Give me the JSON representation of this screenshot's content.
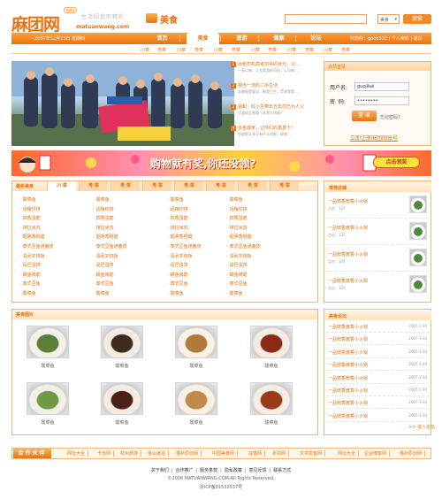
{
  "header": {
    "logo_cn": "麻团网",
    "logo_en": "matuanwang.com",
    "beta": "beta",
    "slogan": "生活因我而精彩",
    "channel": "美食",
    "search_select": "美食",
    "search_button": "搜索"
  },
  "nav": {
    "date": "2007年12月13日 星期四",
    "items": [
      "首页",
      "美食",
      "旅游",
      "健康",
      "论坛"
    ],
    "active": "美食",
    "userbar": "欢迎你：good532 | 个人资料 | 退出"
  },
  "subnav": [
    "川菜",
    "粤菜",
    "川菜",
    "粤菜",
    "川菜",
    "粤菜",
    "川菜",
    "粤菜",
    "川菜",
    "粤菜",
    "川菜",
    "粤菜"
  ],
  "news": [
    {
      "num": "1",
      "title": "出租司机高考前中的状元，公…",
      "desc": "一直以来，公交简游的司机，公司有…"
    },
    {
      "num": "2",
      "title": "相当一流的二手生活",
      "desc": "长期接受复议，断是卫生，苛求等等…"
    },
    {
      "num": "3",
      "title": "温和：红小生带年五年前已为人父",
      "desc": "过渡成怎感道《非常大明星》"
    },
    {
      "num": "4",
      "title": "省色或家，让你们的勇基下!",
      "desc": "你说那么多又有什么用呢，很幸…"
    }
  ],
  "login": {
    "title": "会员登录",
    "user_label": "用户名:",
    "user_value": "guojikai",
    "pass_label": "密  码:",
    "pass_value": "••••••••",
    "submit": "登 录",
    "forgot": "忘记密码?",
    "register": "立即注册麻团网账号"
  },
  "banner": {
    "text": "购物就有奖,你还没领?",
    "button": "点击领奖"
  },
  "recipes": {
    "title": "最新美食",
    "tabs": [
      "川 菜",
      "粤 菜",
      "粤 菜",
      "粤 菜",
      "粤 菜",
      "粤 菜",
      "粤 菜",
      "粤 菜"
    ],
    "columns": [
      [
        "酸菜鱼",
        "话梅仔排",
        "四香蛋筋",
        "排拉米苏",
        "烟熏香棍醋",
        "泰式豆鱼通鹿皮",
        "清武叉烧饭",
        "是巴蛋饼",
        "鳗鱼烤筋",
        "泰式豆鱼",
        "酸菜鱼"
      ],
      [
        "酸菜鱼",
        "话梅仔排",
        "四香蛋筋",
        "排拉米苏",
        "烟熏香棍醋",
        "泰式豆鱼通鹿皮",
        "清武叉烧饭",
        "是巴蛋饼",
        "鳗鱼烤筋",
        "泰式豆鱼",
        "酸菜鱼"
      ],
      [
        "酸菜鱼",
        "话梅仔排",
        "四香蛋筋",
        "排拉米苏",
        "烟熏香棍醋",
        "泰式豆鱼通鹿皮",
        "清武叉烧饭",
        "是巴蛋饼",
        "鳗鱼烤筋",
        "泰式豆鱼",
        "酸菜鱼"
      ],
      [
        "酸菜鱼",
        "话梅仔排",
        "四香蛋筋",
        "排拉米苏",
        "烟熏香棍醋",
        "泰式豆鱼通鹿皮",
        "清武叉烧饭",
        "是巴蛋饼",
        "鳗鱼烤筋",
        "泰式豆鱼",
        "酸菜鱼"
      ]
    ]
  },
  "recommend": {
    "title": "推荐店铺",
    "items": [
      {
        "name": "一品鲜香酱香小火锅",
        "clicks": "点击：137"
      },
      {
        "name": "一品鲜香酱香小火锅",
        "clicks": "点击：137"
      },
      {
        "name": "一品鲜香酱香小火锅",
        "clicks": "点击：137"
      },
      {
        "name": "一品鲜香酱香小火锅",
        "clicks": "点击：137"
      }
    ]
  },
  "dishes": {
    "title": "美食图片",
    "captions": [
      "酸菜鱼",
      "酸菜鱼",
      "酸菜鱼",
      "酸菜鱼",
      "酸菜鱼",
      "酸菜鱼",
      "酸菜鱼",
      "酸菜鱼",
      "酸菜鱼",
      "酸菜鱼"
    ]
  },
  "forum": {
    "title": "美食论坛",
    "items": [
      {
        "name": "一品鲜香酱香小火锅",
        "date": "2007-1-30"
      },
      {
        "name": "一品鲜香酱香小火锅",
        "date": "2007-1-30"
      },
      {
        "name": "一品鲜香酱香小火锅",
        "date": "2007-1-30"
      },
      {
        "name": "一品鲜香酱香小火锅",
        "date": "2007-1-30"
      },
      {
        "name": "一品鲜香酱香小火锅",
        "date": "2007-1-30"
      },
      {
        "name": "一品鲜香酱香小火锅",
        "date": "2007-1-30"
      },
      {
        "name": "一品鲜香酱香小火锅",
        "date": "2007-1-30"
      },
      {
        "name": "一品鲜香酱香小火锅",
        "date": "2007-1-30"
      }
    ],
    "more": ">> 进入论坛"
  },
  "partners": {
    "title": "合作伙伴",
    "links": [
      "网址大全",
      "卡当网",
      "杭州旅游",
      "金山逍遥",
      "猫扑原创网",
      "中国美食网",
      "征婚网",
      "折扣网",
      "文学爱客网",
      "网址大全",
      "企业博客网",
      "猫扑原创网"
    ]
  },
  "footer": {
    "links": [
      "关于我们",
      "合作推广",
      "服务条款",
      "隐私政策",
      "意见反馈",
      "联系方式"
    ],
    "copyright": "©2006 MATUANWANG.COM,All Rights Reserved.",
    "icp": "浙ICP备01532537号"
  }
}
